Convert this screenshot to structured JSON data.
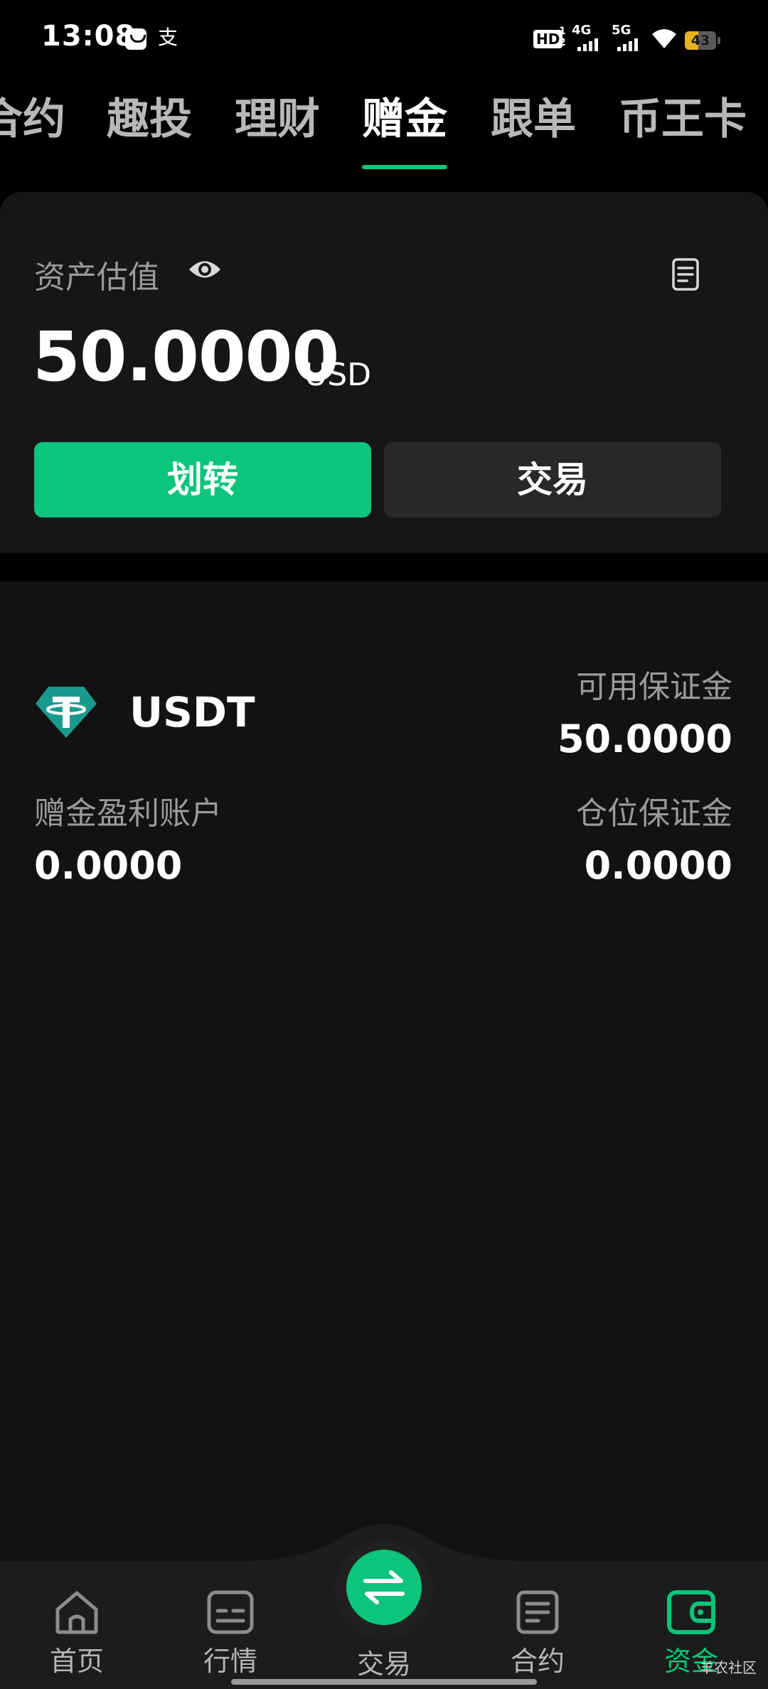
{
  "status_bar": {
    "time": "13:08",
    "alipay_glyph": "支",
    "hd_label": "HD",
    "hd_sup_top": "1",
    "hd_sup_bottom": "2",
    "net1": "4G",
    "net2": "5G",
    "battery": "43",
    "battery_fraction": 0.43,
    "battery_color": "#e7b41f"
  },
  "top_tabs": [
    {
      "label": "合约"
    },
    {
      "label": "趣投"
    },
    {
      "label": "理财"
    },
    {
      "label": "赠金",
      "active": true
    },
    {
      "label": "跟单"
    },
    {
      "label": "币王卡"
    }
  ],
  "asset": {
    "label": "资产估值",
    "amount": "50.0000",
    "unit": "USD",
    "transfer_label": "划转",
    "trade_label": "交易"
  },
  "account": {
    "coin": "USDT",
    "available_margin_label": "可用保证金",
    "available_margin_value": "50.0000",
    "bonus_account_label": "赠金盈利账户",
    "bonus_account_value": "0.0000",
    "position_margin_label": "仓位保证金",
    "position_margin_value": "0.0000"
  },
  "bottom_nav": {
    "home": "首页",
    "market": "行情",
    "trade": "交易",
    "futures": "合约",
    "assets": "资金"
  },
  "watermark": "羊农社区",
  "colors": {
    "accent": "#0cc47b",
    "usdt": "#1a9a8f",
    "background": "#000000",
    "card": "#161616"
  }
}
